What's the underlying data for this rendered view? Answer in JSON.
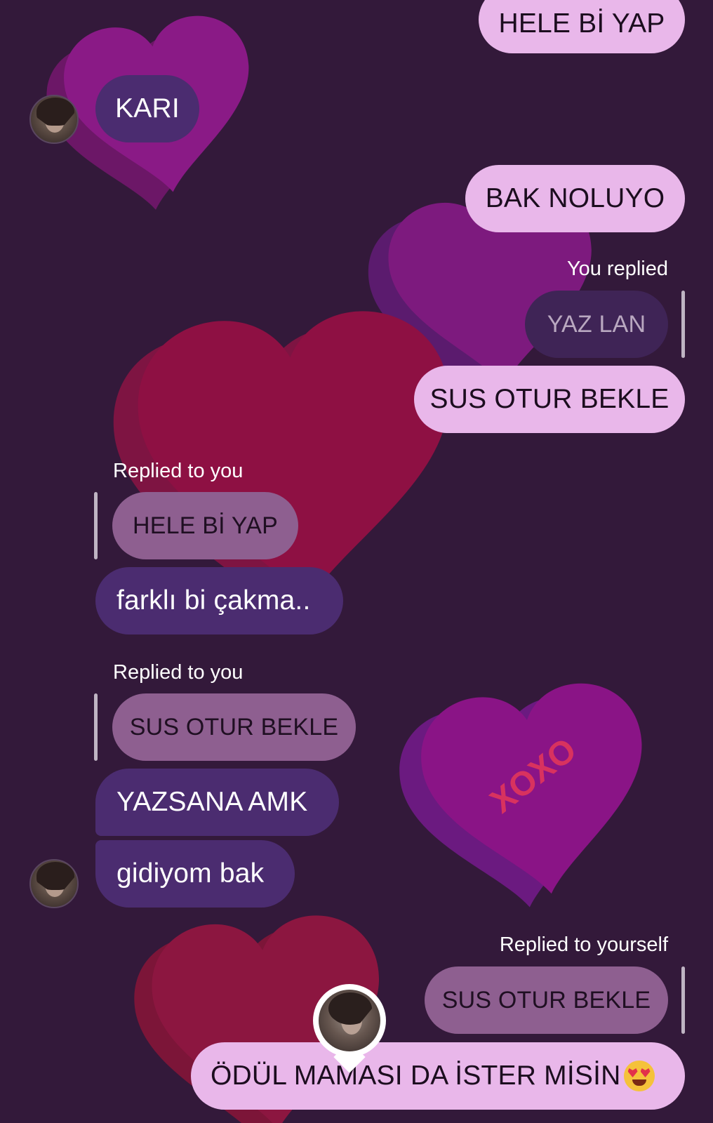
{
  "colors": {
    "background": "#33193a",
    "outgoing_bubble": "#e9b7ea",
    "incoming_bubble": "#4b2c70",
    "reply_preview_outgoing": "#3f2456",
    "reply_preview_incoming": "#8e5f90"
  },
  "messages": [
    {
      "direction": "outgoing",
      "text": "HELE Bİ YAP"
    },
    {
      "direction": "incoming",
      "text": "KARI"
    },
    {
      "direction": "outgoing",
      "text": "BAK NOLUYO"
    },
    {
      "direction": "outgoing",
      "reply_label": "You replied",
      "reply_preview": "YAZ LAN",
      "text": "SUS OTUR BEKLE"
    },
    {
      "direction": "incoming",
      "reply_label": "Replied to you",
      "reply_preview": "HELE Bİ YAP",
      "text": "farklı bi çakma.."
    },
    {
      "direction": "incoming",
      "reply_label": "Replied to you",
      "reply_preview": "SUS OTUR BEKLE",
      "text": "YAZSANA AMK"
    },
    {
      "direction": "incoming",
      "text": "gidiyom bak"
    },
    {
      "direction": "outgoing",
      "reply_label": "Replied to yourself",
      "reply_preview": "SUS OTUR BEKLE",
      "text": "ÖDÜL MAMASI DA İSTER MİSİN",
      "emoji": "heart-eyes-emoji"
    }
  ],
  "decor": {
    "heart_text": "XOXO",
    "theme": "hearts"
  }
}
